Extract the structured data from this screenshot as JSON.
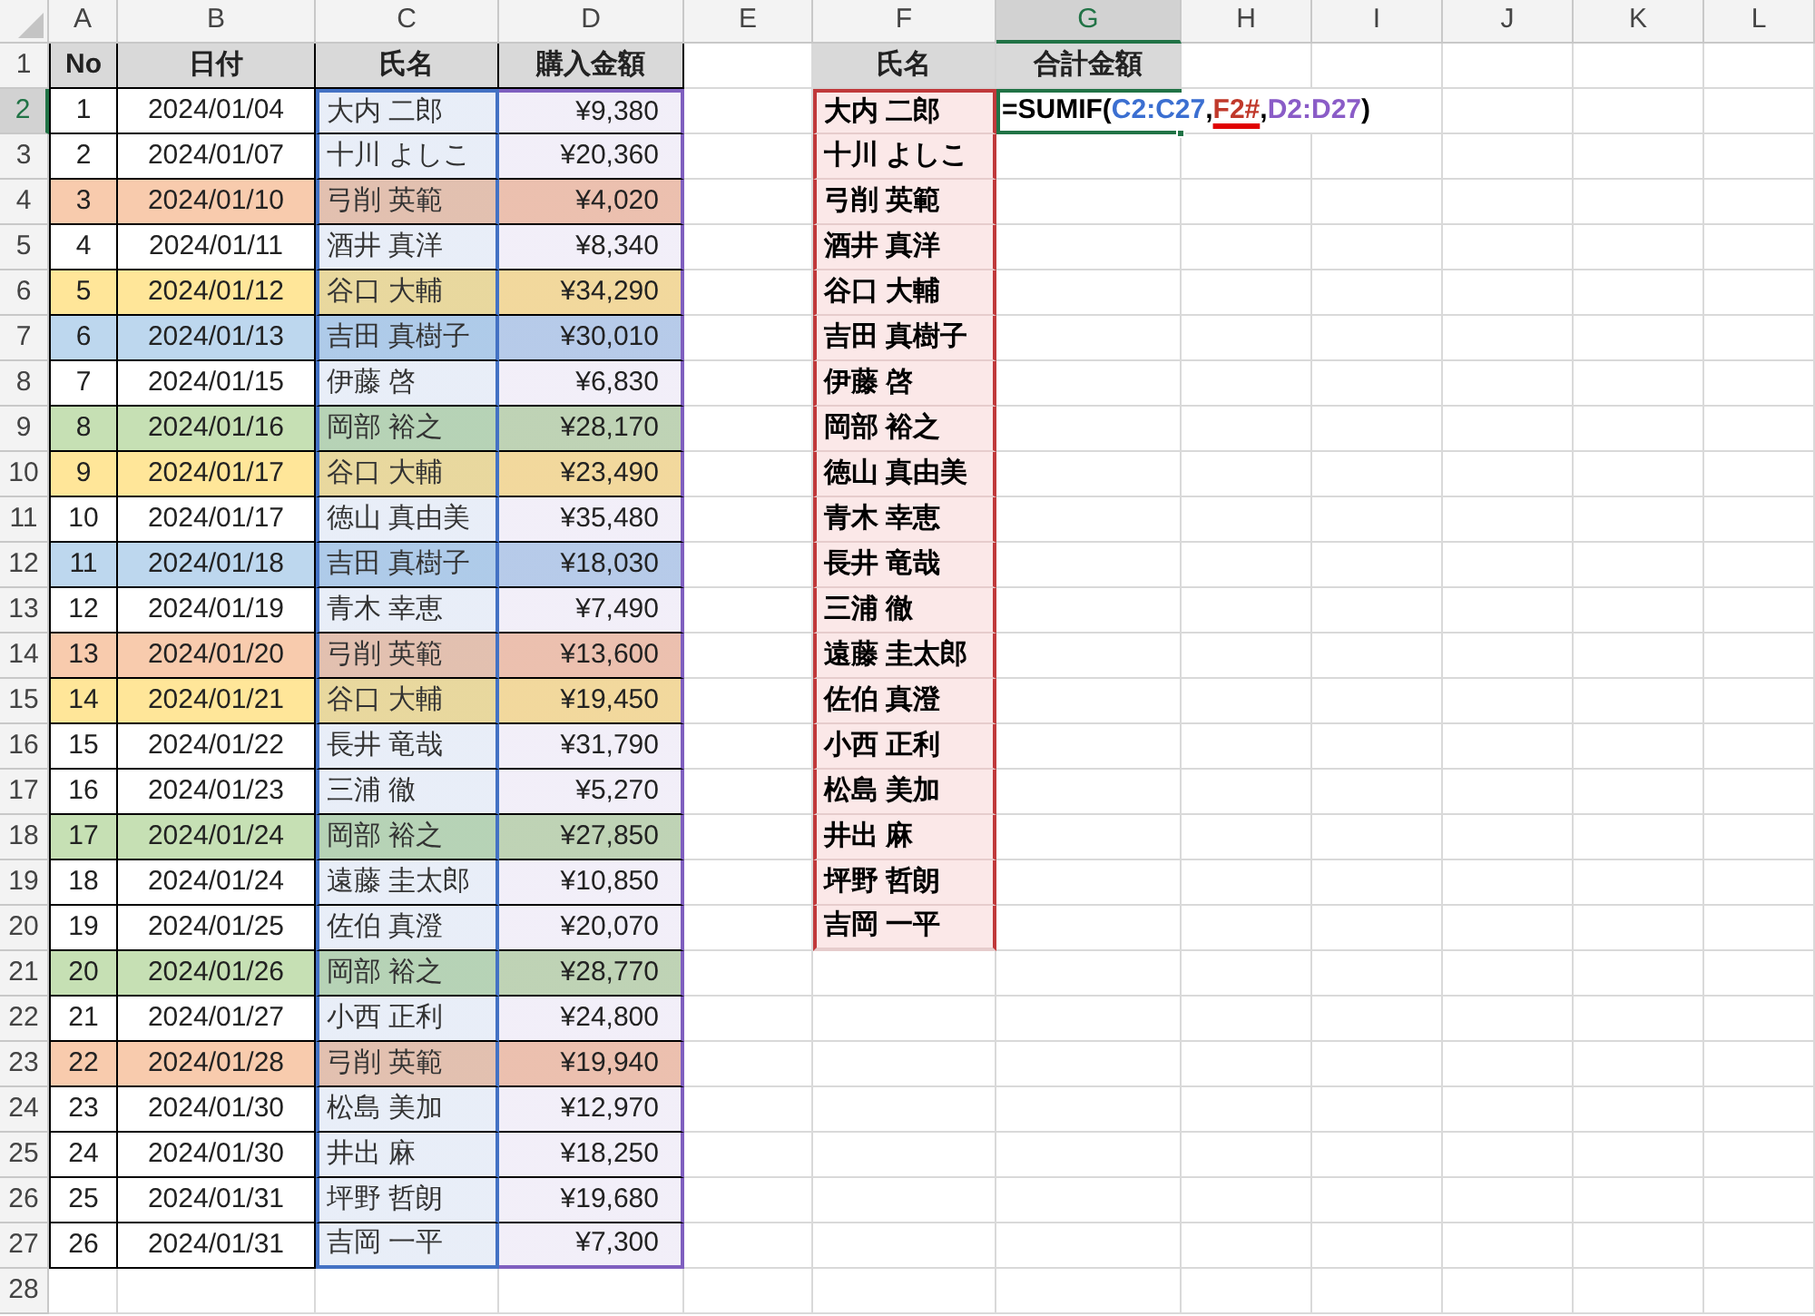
{
  "column_headers": [
    {
      "label": "A",
      "selected": false
    },
    {
      "label": "B",
      "selected": false
    },
    {
      "label": "C",
      "selected": false
    },
    {
      "label": "D",
      "selected": false
    },
    {
      "label": "E",
      "selected": false
    },
    {
      "label": "F",
      "selected": false
    },
    {
      "label": "G",
      "selected": true
    },
    {
      "label": "H",
      "selected": false
    },
    {
      "label": "I",
      "selected": false
    },
    {
      "label": "J",
      "selected": false
    },
    {
      "label": "K",
      "selected": false
    },
    {
      "label": "L",
      "selected": false
    }
  ],
  "row_headers": [
    {
      "label": "1",
      "selected": false
    },
    {
      "label": "2",
      "selected": true
    },
    {
      "label": "3",
      "selected": false
    },
    {
      "label": "4",
      "selected": false
    },
    {
      "label": "5",
      "selected": false
    },
    {
      "label": "6",
      "selected": false
    },
    {
      "label": "7",
      "selected": false
    },
    {
      "label": "8",
      "selected": false
    },
    {
      "label": "9",
      "selected": false
    },
    {
      "label": "10",
      "selected": false
    },
    {
      "label": "11",
      "selected": false
    },
    {
      "label": "12",
      "selected": false
    },
    {
      "label": "13",
      "selected": false
    },
    {
      "label": "14",
      "selected": false
    },
    {
      "label": "15",
      "selected": false
    },
    {
      "label": "16",
      "selected": false
    },
    {
      "label": "17",
      "selected": false
    },
    {
      "label": "18",
      "selected": false
    },
    {
      "label": "19",
      "selected": false
    },
    {
      "label": "20",
      "selected": false
    },
    {
      "label": "21",
      "selected": false
    },
    {
      "label": "22",
      "selected": false
    },
    {
      "label": "23",
      "selected": false
    },
    {
      "label": "24",
      "selected": false
    },
    {
      "label": "25",
      "selected": false
    },
    {
      "label": "26",
      "selected": false
    },
    {
      "label": "27",
      "selected": false
    },
    {
      "label": "28",
      "selected": false
    }
  ],
  "table": {
    "columns": [
      "No",
      "日付",
      "氏名",
      "購入金額"
    ],
    "rows": [
      {
        "no": "1",
        "date": "2024/01/04",
        "name": "大内 二郎",
        "amount": "¥9,380"
      },
      {
        "no": "2",
        "date": "2024/01/07",
        "name": "十川 よしこ",
        "amount": "¥20,360"
      },
      {
        "no": "3",
        "date": "2024/01/10",
        "name": "弓削 英範",
        "amount": "¥4,020",
        "color": "#f8cbad"
      },
      {
        "no": "4",
        "date": "2024/01/11",
        "name": "酒井 真洋",
        "amount": "¥8,340"
      },
      {
        "no": "5",
        "date": "2024/01/12",
        "name": "谷口 大輔",
        "amount": "¥34,290",
        "color": "#ffe699"
      },
      {
        "no": "6",
        "date": "2024/01/13",
        "name": "吉田 真樹子",
        "amount": "¥30,010",
        "color": "#bdd7ee"
      },
      {
        "no": "7",
        "date": "2024/01/15",
        "name": "伊藤 啓",
        "amount": "¥6,830"
      },
      {
        "no": "8",
        "date": "2024/01/16",
        "name": "岡部 裕之",
        "amount": "¥28,170",
        "color": "#c6e0b4"
      },
      {
        "no": "9",
        "date": "2024/01/17",
        "name": "谷口 大輔",
        "amount": "¥23,490",
        "color": "#ffe699"
      },
      {
        "no": "10",
        "date": "2024/01/17",
        "name": "徳山 真由美",
        "amount": "¥35,480"
      },
      {
        "no": "11",
        "date": "2024/01/18",
        "name": "吉田 真樹子",
        "amount": "¥18,030",
        "color": "#bdd7ee"
      },
      {
        "no": "12",
        "date": "2024/01/19",
        "name": "青木 幸恵",
        "amount": "¥7,490"
      },
      {
        "no": "13",
        "date": "2024/01/20",
        "name": "弓削 英範",
        "amount": "¥13,600",
        "color": "#f8cbad"
      },
      {
        "no": "14",
        "date": "2024/01/21",
        "name": "谷口 大輔",
        "amount": "¥19,450",
        "color": "#ffe699"
      },
      {
        "no": "15",
        "date": "2024/01/22",
        "name": "長井 竜哉",
        "amount": "¥31,790"
      },
      {
        "no": "16",
        "date": "2024/01/23",
        "name": "三浦 徹",
        "amount": "¥5,270"
      },
      {
        "no": "17",
        "date": "2024/01/24",
        "name": "岡部 裕之",
        "amount": "¥27,850",
        "color": "#c6e0b4"
      },
      {
        "no": "18",
        "date": "2024/01/24",
        "name": "遠藤 圭太郎",
        "amount": "¥10,850"
      },
      {
        "no": "19",
        "date": "2024/01/25",
        "name": "佐伯 真澄",
        "amount": "¥20,070"
      },
      {
        "no": "20",
        "date": "2024/01/26",
        "name": "岡部 裕之",
        "amount": "¥28,770",
        "color": "#c6e0b4"
      },
      {
        "no": "21",
        "date": "2024/01/27",
        "name": "小西 正利",
        "amount": "¥24,800"
      },
      {
        "no": "22",
        "date": "2024/01/28",
        "name": "弓削 英範",
        "amount": "¥19,940",
        "color": "#f8cbad"
      },
      {
        "no": "23",
        "date": "2024/01/30",
        "name": "松島 美加",
        "amount": "¥12,970"
      },
      {
        "no": "24",
        "date": "2024/01/30",
        "name": "井出 麻",
        "amount": "¥18,250"
      },
      {
        "no": "25",
        "date": "2024/01/31",
        "name": "坪野 哲朗",
        "amount": "¥19,680"
      },
      {
        "no": "26",
        "date": "2024/01/31",
        "name": "吉岡 一平",
        "amount": "¥7,300"
      }
    ]
  },
  "lookup": {
    "header": "氏名",
    "names": [
      "大内 二郎",
      "十川 よしこ",
      "弓削 英範",
      "酒井 真洋",
      "谷口 大輔",
      "吉田 真樹子",
      "伊藤 啓",
      "岡部 裕之",
      "徳山 真由美",
      "青木 幸恵",
      "長井 竜哉",
      "三浦 徹",
      "遠藤 圭太郎",
      "佐伯 真澄",
      "小西 正利",
      "松島 美加",
      "井出 麻",
      "坪野 哲朗",
      "吉岡 一平"
    ]
  },
  "result": {
    "header": "合計金額",
    "selected": true,
    "formula": [
      {
        "text": "=SUMIF(",
        "color": "#000000",
        "underlined": false
      },
      {
        "text": "C2:C27",
        "color": "#3b6fd1",
        "underlined": false
      },
      {
        "text": ",",
        "color": "#000000",
        "underlined": false
      },
      {
        "text": "F2#",
        "color": "#c0392b",
        "underlined": true
      },
      {
        "text": ",",
        "color": "#000000",
        "underlined": false
      },
      {
        "text": "D2:D27",
        "color": "#8a5cc7",
        "underlined": false
      },
      {
        "text": ")",
        "color": "#000000",
        "underlined": false
      }
    ]
  }
}
